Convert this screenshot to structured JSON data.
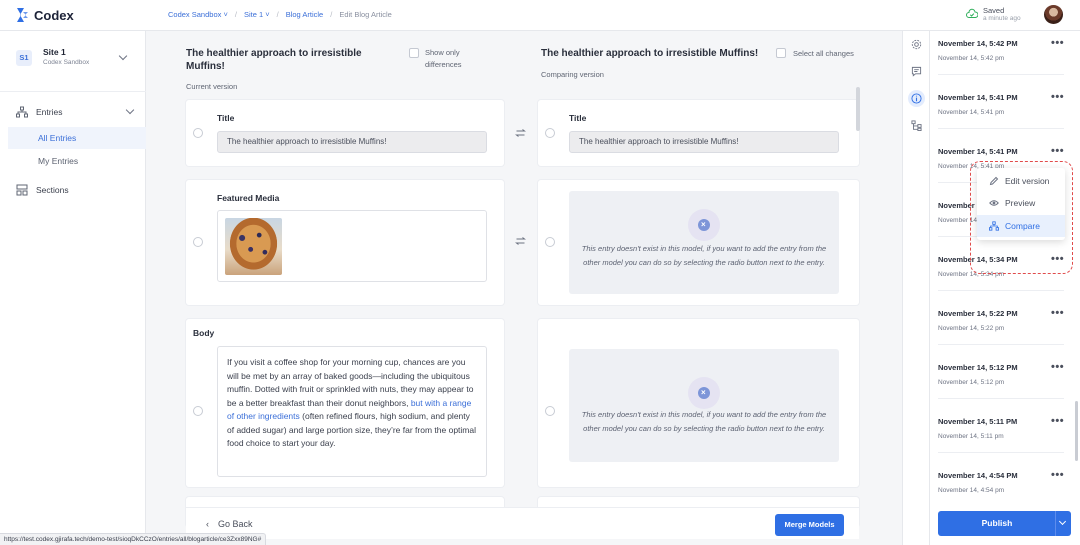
{
  "app": {
    "name": "Codex"
  },
  "breadcrumb": [
    "Codex Sandbox",
    "Site 1",
    "Blog Article",
    "Edit Blog Article"
  ],
  "save_status": {
    "title": "Saved",
    "subtitle": "a minute ago"
  },
  "site": {
    "badge": "S1",
    "name": "Site 1",
    "workspace": "Codex Sandbox"
  },
  "nav": {
    "entries": "Entries",
    "all_entries": "All Entries",
    "my_entries": "My Entries",
    "sections": "Sections"
  },
  "compare": {
    "current": {
      "title": "The healthier approach to irresistible Muffins!",
      "caption": "Current version",
      "show_only_differences": "Show only differences"
    },
    "comparing": {
      "title": "The healthier approach to irresistible Muffins!",
      "caption": "Comparing version",
      "select_all": "Select all changes"
    },
    "fields": {
      "title_label": "Title",
      "title_value_current": "The healthier approach to irresistible Muffins!",
      "title_value_comparing": "The healthier approach to irresistible Muffins!",
      "featured_media_label": "Featured Media",
      "body_label": "Body",
      "body_before_link": "If you visit a coffee shop for your morning cup, chances are you will be met by an array of baked goods—including the ubiquitous muffin. Dotted with fruit or sprinkled with nuts, they may appear to be a better breakfast than their donut neighbors, ",
      "body_link": "but with a range of other ingredients",
      "body_after_link": " (often refined flours, high sodium, and plenty of added sugar) and large portion size, they’re far from the optimal food choice to start your day."
    },
    "empty_message": "This entry doesn't exist in this model, if you want to add the entry from the other model you can do so by selecting the radio button next to the entry.",
    "back": "Go Back",
    "merge": "Merge Models"
  },
  "versions": [
    {
      "title": "November 14, 5:42 PM",
      "subtitle": "November 14, 5:42 pm"
    },
    {
      "title": "November 14, 5:41 PM",
      "subtitle": "November 14, 5:41 pm"
    },
    {
      "title": "November 14, 5:41 PM",
      "subtitle": "November 14, 5:41 pm"
    },
    {
      "title": "November 14, 5:41 PM",
      "subtitle": "November 14, 5:41 pm"
    },
    {
      "title": "November 14, 5:34 PM",
      "subtitle": "November 14, 5:34 pm"
    },
    {
      "title": "November 14, 5:22 PM",
      "subtitle": "November 14, 5:22 pm"
    },
    {
      "title": "November 14, 5:12 PM",
      "subtitle": "November 14, 5:12 pm"
    },
    {
      "title": "November 14, 5:11 PM",
      "subtitle": "November 14, 5:11 pm"
    },
    {
      "title": "November 14, 4:54 PM",
      "subtitle": "November 14, 4:54 pm"
    }
  ],
  "version_menu": {
    "edit": "Edit version",
    "preview": "Preview",
    "compare": "Compare"
  },
  "publish": "Publish",
  "status_url": "https://test.codex.gjirafa.tech/demo-test/sioqDkCCzO/entries/all/blogarticle/ce3Zxx89NG#",
  "colors": {
    "accent": "#2f6fe4",
    "highlight_dashed": "#e04b4b"
  },
  "icons": [
    "codex-logo-icon",
    "cloud-check-icon",
    "chevron-down-icon",
    "entries-icon",
    "sections-icon",
    "settings-icon",
    "comments-icon",
    "info-icon",
    "hierarchy-icon",
    "swap-icon",
    "more-icon",
    "pencil-icon",
    "eye-icon",
    "compare-icon",
    "chevron-left-icon"
  ]
}
